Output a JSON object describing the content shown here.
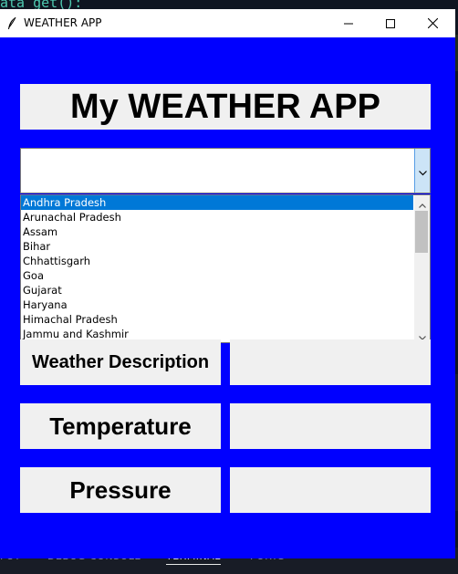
{
  "background": {
    "code_line": "ata_get():",
    "panel_tabs": [
      "PUT",
      "DEBUG CONSOLE",
      "TERMINAL",
      "PORTS"
    ],
    "active_tab": "TERMINAL"
  },
  "window": {
    "title": "WEATHER APP",
    "background_color": "#0000ff",
    "controls": {
      "minimize": "minimize",
      "maximize": "maximize",
      "close": "close"
    }
  },
  "app": {
    "heading": "My WEATHER APP",
    "state_select": {
      "value": "",
      "options": [
        "Andhra Pradesh",
        "Arunachal Pradesh",
        "Assam",
        "Bihar",
        "Chhattisgarh",
        "Goa",
        "Gujarat",
        "Haryana",
        "Himachal Pradesh",
        "Jammu and Kashmir"
      ],
      "highlighted_option": "Andhra Pradesh"
    },
    "fields": [
      {
        "label": "Weather Description",
        "value": ""
      },
      {
        "label": "Temperature",
        "value": ""
      },
      {
        "label": "Pressure",
        "value": ""
      }
    ]
  },
  "colors": {
    "selection": "#0078d7",
    "panel": "#f0f0f0",
    "window_bg": "#0000ff"
  }
}
